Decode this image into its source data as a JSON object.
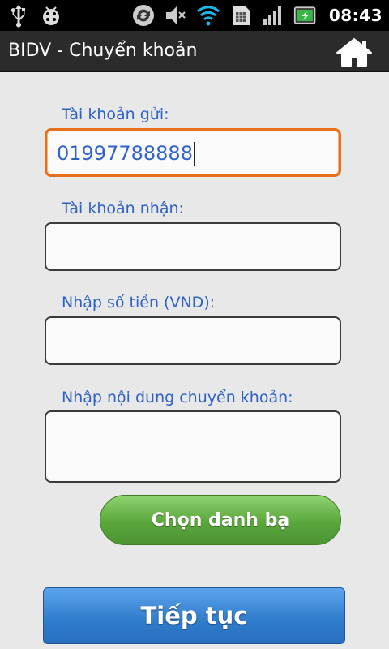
{
  "status_bar": {
    "time": "08:43",
    "icons": [
      "usb-icon",
      "debug-bug-icon",
      "sync-icon",
      "mute-icon",
      "wifi-icon",
      "sim-icon",
      "signal-icon",
      "battery-charging-icon"
    ]
  },
  "titlebar": {
    "title": "BIDV - Chuyển khoản",
    "home_icon": "home-icon"
  },
  "form": {
    "sender_label": "Tài khoản gửi:",
    "sender_value": "01997788888",
    "receiver_label": "Tài khoản nhận:",
    "receiver_value": "",
    "amount_label": "Nhập số tiền (VND):",
    "amount_value": "",
    "content_label": "Nhập nội dung chuyển khoản:",
    "content_value": ""
  },
  "buttons": {
    "contacts_label": "Chọn danh bạ",
    "continue_label": "Tiếp tục"
  },
  "colors": {
    "label_blue": "#2e62c9",
    "focus_orange": "#e8701a",
    "button_green": "#5aa63c",
    "button_blue": "#2f7ccc"
  }
}
